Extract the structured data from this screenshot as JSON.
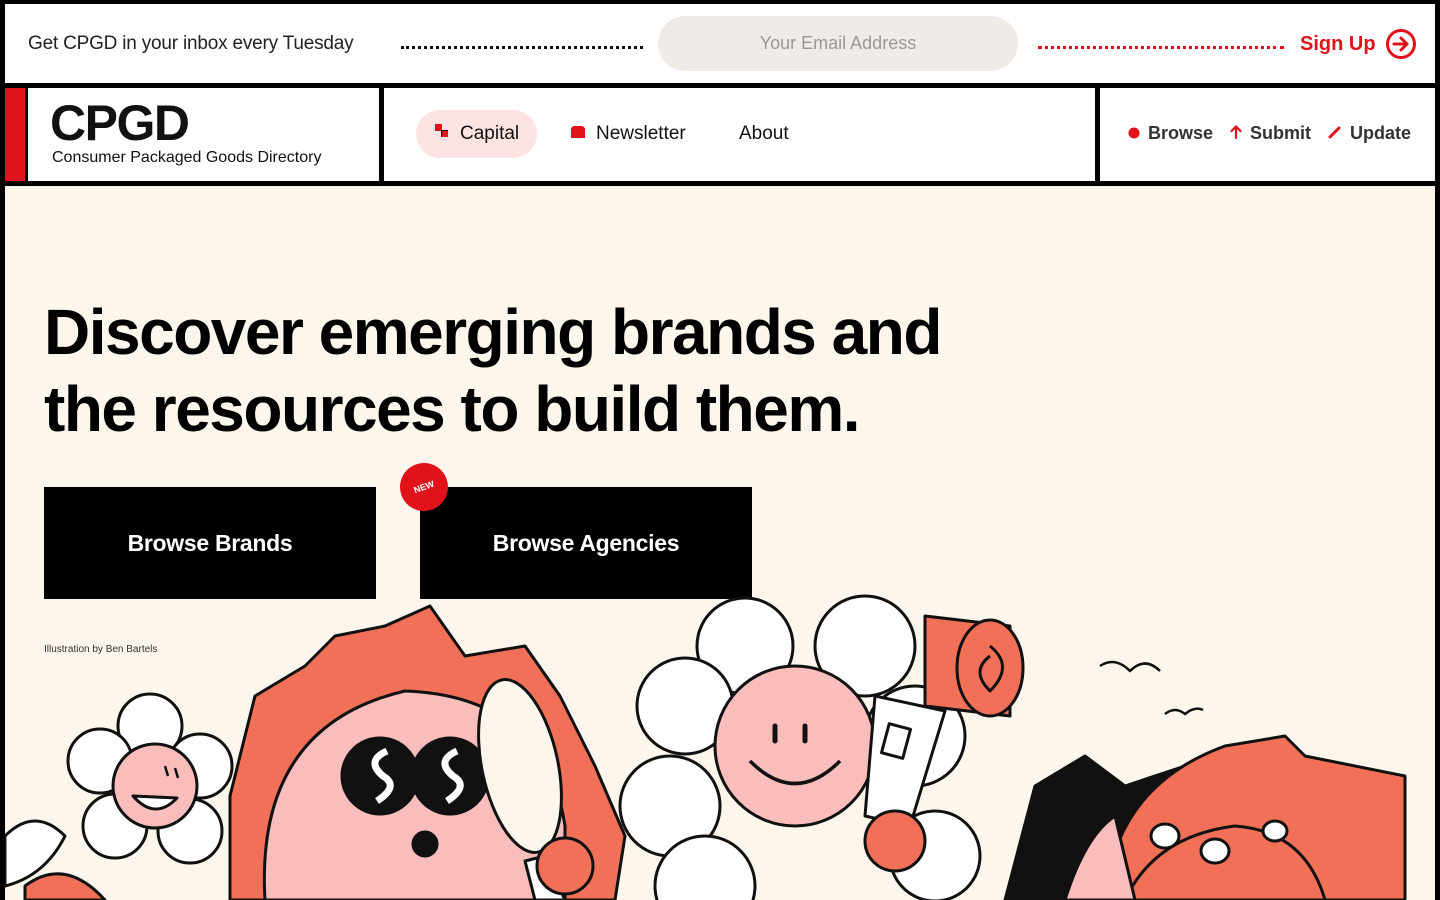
{
  "topbar": {
    "promo": "Get CPGD in your inbox every Tuesday",
    "email_placeholder": "Your Email Address",
    "signup_label": "Sign Up",
    "signup_icon": "arrow-right-circle-icon"
  },
  "header": {
    "logo_title": "CPGD",
    "logo_subtitle": "Consumer Packaged Goods Directory",
    "nav": [
      {
        "label": "Capital",
        "icon": "capital-squares-icon",
        "active": true
      },
      {
        "label": "Newsletter",
        "icon": "newsletter-icon",
        "active": false
      },
      {
        "label": "About",
        "active": false
      }
    ],
    "actions": [
      {
        "label": "Browse",
        "icon": "dot-icon"
      },
      {
        "label": "Submit",
        "icon": "arrow-up-icon"
      },
      {
        "label": "Update",
        "icon": "pencil-icon"
      }
    ]
  },
  "hero": {
    "headline": "Discover emerging brands and the resources to build them.",
    "btn_brands": "Browse Brands",
    "btn_agencies": "Browse Agencies",
    "badge": "NEW",
    "credit": "Illustration by Ben Bartels"
  },
  "colors": {
    "accent": "#e2121b",
    "hero_bg": "#fdf6ec",
    "pill_bg": "#efebe6",
    "active_nav_bg": "#fde4e2",
    "illustration_salmon": "#f07158",
    "illustration_pink": "#f9bdbb"
  }
}
